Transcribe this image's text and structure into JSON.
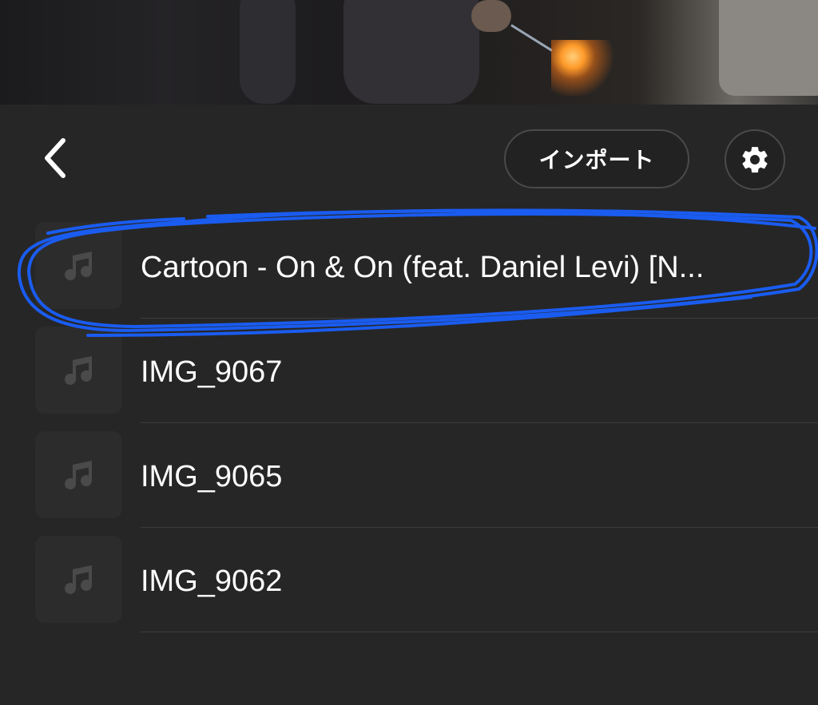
{
  "header": {
    "back_icon": "chevron-left-icon",
    "import_label": "インポート",
    "settings_icon": "gear-icon"
  },
  "tracks": [
    {
      "title": "Cartoon - On & On (feat. Daniel Levi) [N...",
      "icon": "music-note-icon",
      "highlighted": true
    },
    {
      "title": "IMG_9067",
      "icon": "music-note-icon",
      "highlighted": false
    },
    {
      "title": "IMG_9065",
      "icon": "music-note-icon",
      "highlighted": false
    },
    {
      "title": "IMG_9062",
      "icon": "music-note-icon",
      "highlighted": false
    }
  ],
  "colors": {
    "background": "#262626",
    "highlight_stroke": "#1a5cf0",
    "thumb": "#2c2c2c",
    "text": "#ffffff"
  }
}
